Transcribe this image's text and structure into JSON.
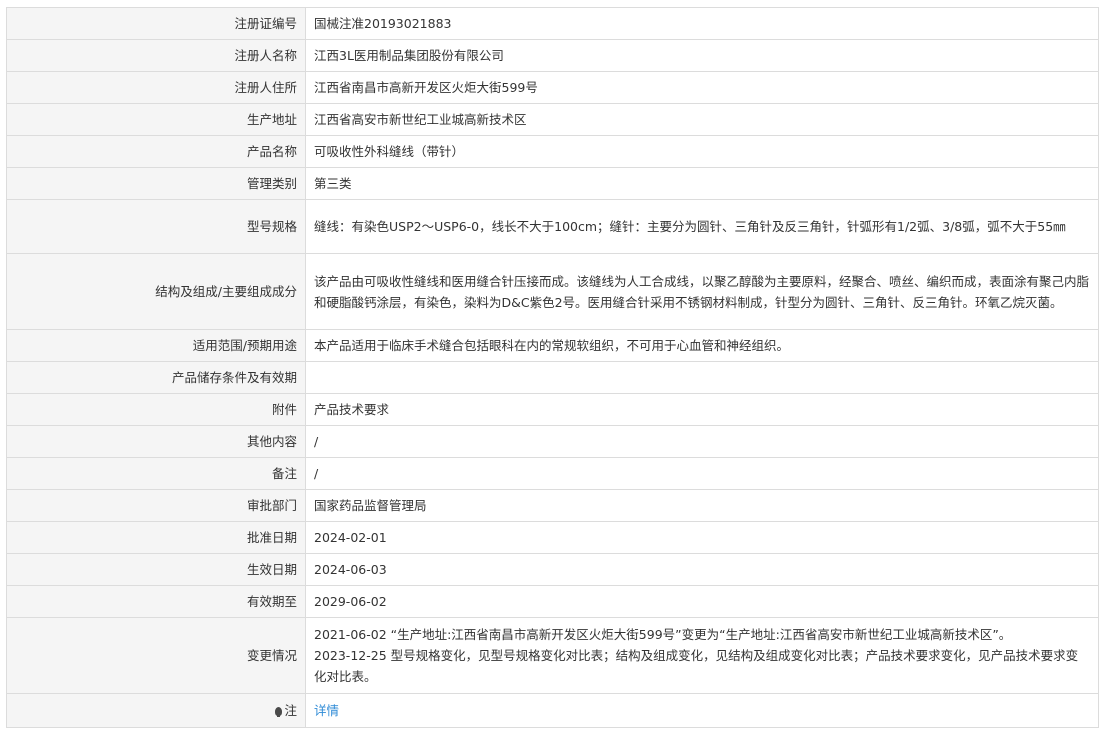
{
  "rows": [
    {
      "label": "注册证编号",
      "value": "国械注准20193021883"
    },
    {
      "label": "注册人名称",
      "value": "江西3L医用制品集团股份有限公司"
    },
    {
      "label": "注册人住所",
      "value": "江西省南昌市高新开发区火炬大街599号"
    },
    {
      "label": "生产地址",
      "value": "江西省高安市新世纪工业城高新技术区"
    },
    {
      "label": "产品名称",
      "value": "可吸收性外科缝线（带针）"
    },
    {
      "label": "管理类别",
      "value": "第三类"
    },
    {
      "label": "型号规格",
      "value": "缝线：有染色USP2～USP6-0，线长不大于100cm；缝针：主要分为圆针、三角针及反三角针，针弧形有1/2弧、3/8弧，弧不大于55㎜"
    },
    {
      "label": "结构及组成/主要组成成分",
      "value": "该产品由可吸收性缝线和医用缝合针压接而成。该缝线为人工合成线，以聚乙醇酸为主要原料，经聚合、喷丝、编织而成，表面涂有聚己内脂和硬脂酸钙涂层，有染色，染料为D&C紫色2号。医用缝合针采用不锈钢材料制成，针型分为圆针、三角针、反三角针。环氧乙烷灭菌。"
    },
    {
      "label": "适用范围/预期用途",
      "value": "本产品适用于临床手术缝合包括眼科在内的常规软组织，不可用于心血管和神经组织。"
    },
    {
      "label": "产品储存条件及有效期",
      "value": ""
    },
    {
      "label": "附件",
      "value": "产品技术要求"
    },
    {
      "label": "其他内容",
      "value": "/"
    },
    {
      "label": "备注",
      "value": "/"
    },
    {
      "label": "审批部门",
      "value": "国家药品监督管理局"
    },
    {
      "label": "批准日期",
      "value": "2024-02-01"
    },
    {
      "label": "生效日期",
      "value": "2024-06-03"
    },
    {
      "label": "有效期至",
      "value": "2029-06-02"
    }
  ],
  "changes": {
    "label": "变更情况",
    "lines": [
      "2021-06-02 “生产地址:江西省南昌市高新开发区火炬大街599号”变更为“生产地址:江西省高安市新世纪工业城高新技术区”。",
      "2023-12-25 型号规格变化，见型号规格变化对比表；结构及组成变化，见结构及组成变化对比表；产品技术要求变化，见产品技术要求变化对比表。"
    ]
  },
  "note": {
    "icon": "lightbulb-icon",
    "label": "注",
    "link_text": "详情"
  }
}
